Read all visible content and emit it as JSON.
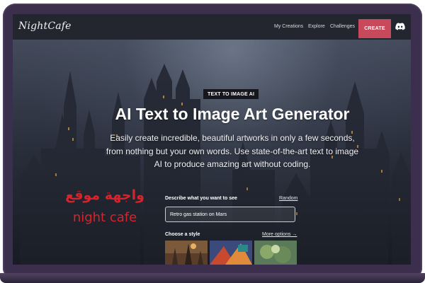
{
  "navbar": {
    "logo": "NightCafe",
    "links": [
      "My Creations",
      "Explore",
      "Challenges"
    ],
    "create_label": "CREATE"
  },
  "hero": {
    "badge": "TEXT TO IMAGE AI",
    "title": "AI Text to Image Art Generator",
    "description": "Easily create incredible, beautiful artworks in only a few seconds, from nothing but your own words. Use state-of-the-art text to image AI to produce amazing art without coding."
  },
  "overlay": {
    "arabic_title": "واجهة موقع",
    "subtitle": "night cafe"
  },
  "form": {
    "prompt_label": "Describe what you want to see",
    "random_label": "Random",
    "prompt_value": "Retro gas station on Mars",
    "style_label": "Choose a style",
    "more_options_label": "More options →"
  },
  "colors": {
    "create_button": "#c8495c",
    "overlay_text": "#d8232a",
    "frame": "#3b2f4d"
  },
  "icons": {
    "discord": "discord-icon"
  }
}
